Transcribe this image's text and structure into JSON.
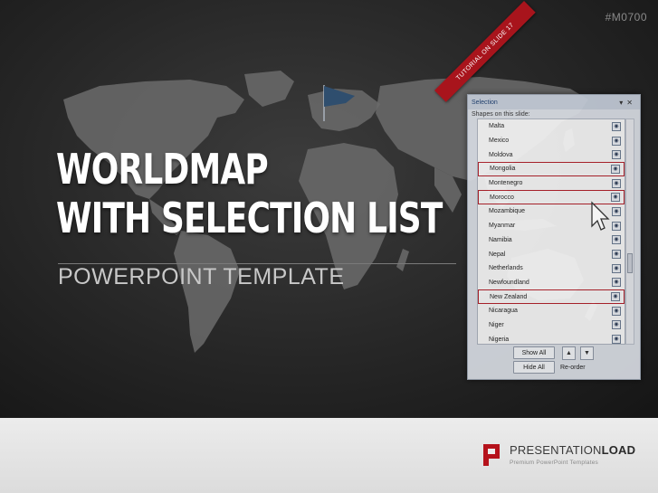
{
  "slide": {
    "code": "#M0700",
    "title_line1": "WORLDMAP",
    "title_line2": "WITH SELECTION LIST",
    "subtitle": "POWERPOINT TEMPLATE",
    "ribbon": "TUTORIAL ON SLIDE 17"
  },
  "panel": {
    "title": "Selection",
    "shapes_label": "Shapes on this slide:",
    "items": [
      {
        "label": "Malta",
        "highlighted": false
      },
      {
        "label": "Mexico",
        "highlighted": false
      },
      {
        "label": "Moldova",
        "highlighted": false
      },
      {
        "label": "Mongolia",
        "highlighted": true
      },
      {
        "label": "Montenegro",
        "highlighted": false
      },
      {
        "label": "Morocco",
        "highlighted": true
      },
      {
        "label": "Mozambique",
        "highlighted": false
      },
      {
        "label": "Myanmar",
        "highlighted": false
      },
      {
        "label": "Namibia",
        "highlighted": false
      },
      {
        "label": "Nepal",
        "highlighted": false
      },
      {
        "label": "Netherlands",
        "highlighted": false
      },
      {
        "label": "Newfoundland",
        "highlighted": false
      },
      {
        "label": "New Zealand",
        "highlighted": true
      },
      {
        "label": "Nicaragua",
        "highlighted": false
      },
      {
        "label": "Niger",
        "highlighted": false
      },
      {
        "label": "Nigeria",
        "highlighted": false
      }
    ],
    "show_all": "Show All",
    "hide_all": "Hide All",
    "reorder": "Re-order"
  },
  "footer": {
    "brand_prefix": "PRESENTATION",
    "brand_bold": "LOAD",
    "tagline": "Premium PowerPoint Templates"
  },
  "colors": {
    "accent_red": "#a8141c",
    "highlight_border": "#b0202a"
  }
}
